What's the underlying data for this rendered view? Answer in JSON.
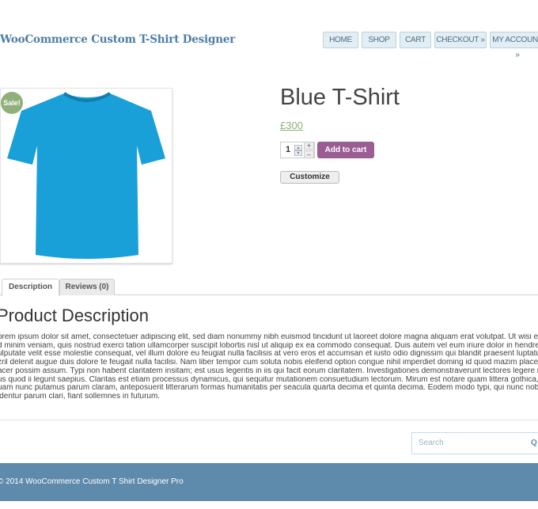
{
  "header": {
    "site_title": "WooCommerce Custom T-Shirt Designer",
    "nav": [
      "HOME",
      "SHOP",
      "CART",
      "CHECKOUT »",
      "MY ACCOUNT »"
    ]
  },
  "product": {
    "sale_badge": "Sale!",
    "title": "Blue T-Shirt",
    "price": "£300",
    "quantity": "1",
    "add_to_cart": "Add to cart",
    "customize": "Customize",
    "shirt_color": "#1aa0d8"
  },
  "tabs": [
    {
      "label": "Description",
      "active": true
    },
    {
      "label": "Reviews (0)",
      "active": false
    }
  ],
  "description": {
    "heading": "Product Description",
    "lines": [
      "orem ipsum dolor sit amet, consectetuer adipiscing elit, sed diam nonummy nibh euismod tincidunt ut laoreet dolore magna aliquam erat volutpat. Ut wisi enim",
      "d minim veniam, quis nostrud exerci tation ullamcorper suscipit lobortis nisl ut aliquip ex ea commodo consequat. Duis autem vel eum iriure dolor in hendrerit in",
      "ulputate velit esse molestie consequat, vel illum dolore eu feugiat nulla facilisis at vero eros et accumsan et iusto odio dignissim qui blandit praesent luptatum",
      "zril delenit augue duis dolore te feugait nulla facilisi. Nam liber tempor cum soluta nobis eleifend option congue nihil imperdiet doming id quod mazim placerat",
      "acer possim assum. Typi non habent claritatem insitam; est usus legentis in iis qui facit eorum claritatem. Investigationes demonstraverunt lectores legere me",
      "us quod ii legunt saepius. Claritas est etiam processus dynamicus, qui sequitur mutationem consuetudium lectorum. Mirum est notare quam littera gothica,",
      "uam nunc putamus parum claram, anteposuerit litterarum formas humanitatis per seacula quarta decima et quinta decima. Eodem modo typi, qui nunc nobis",
      "identur parum clari, fiant sollemnes in futurum."
    ]
  },
  "search": {
    "placeholder": "Search"
  },
  "footer": {
    "copyright": "© 2014 ",
    "link": "WooCommerce Custom T Shirt Designer Pro"
  }
}
